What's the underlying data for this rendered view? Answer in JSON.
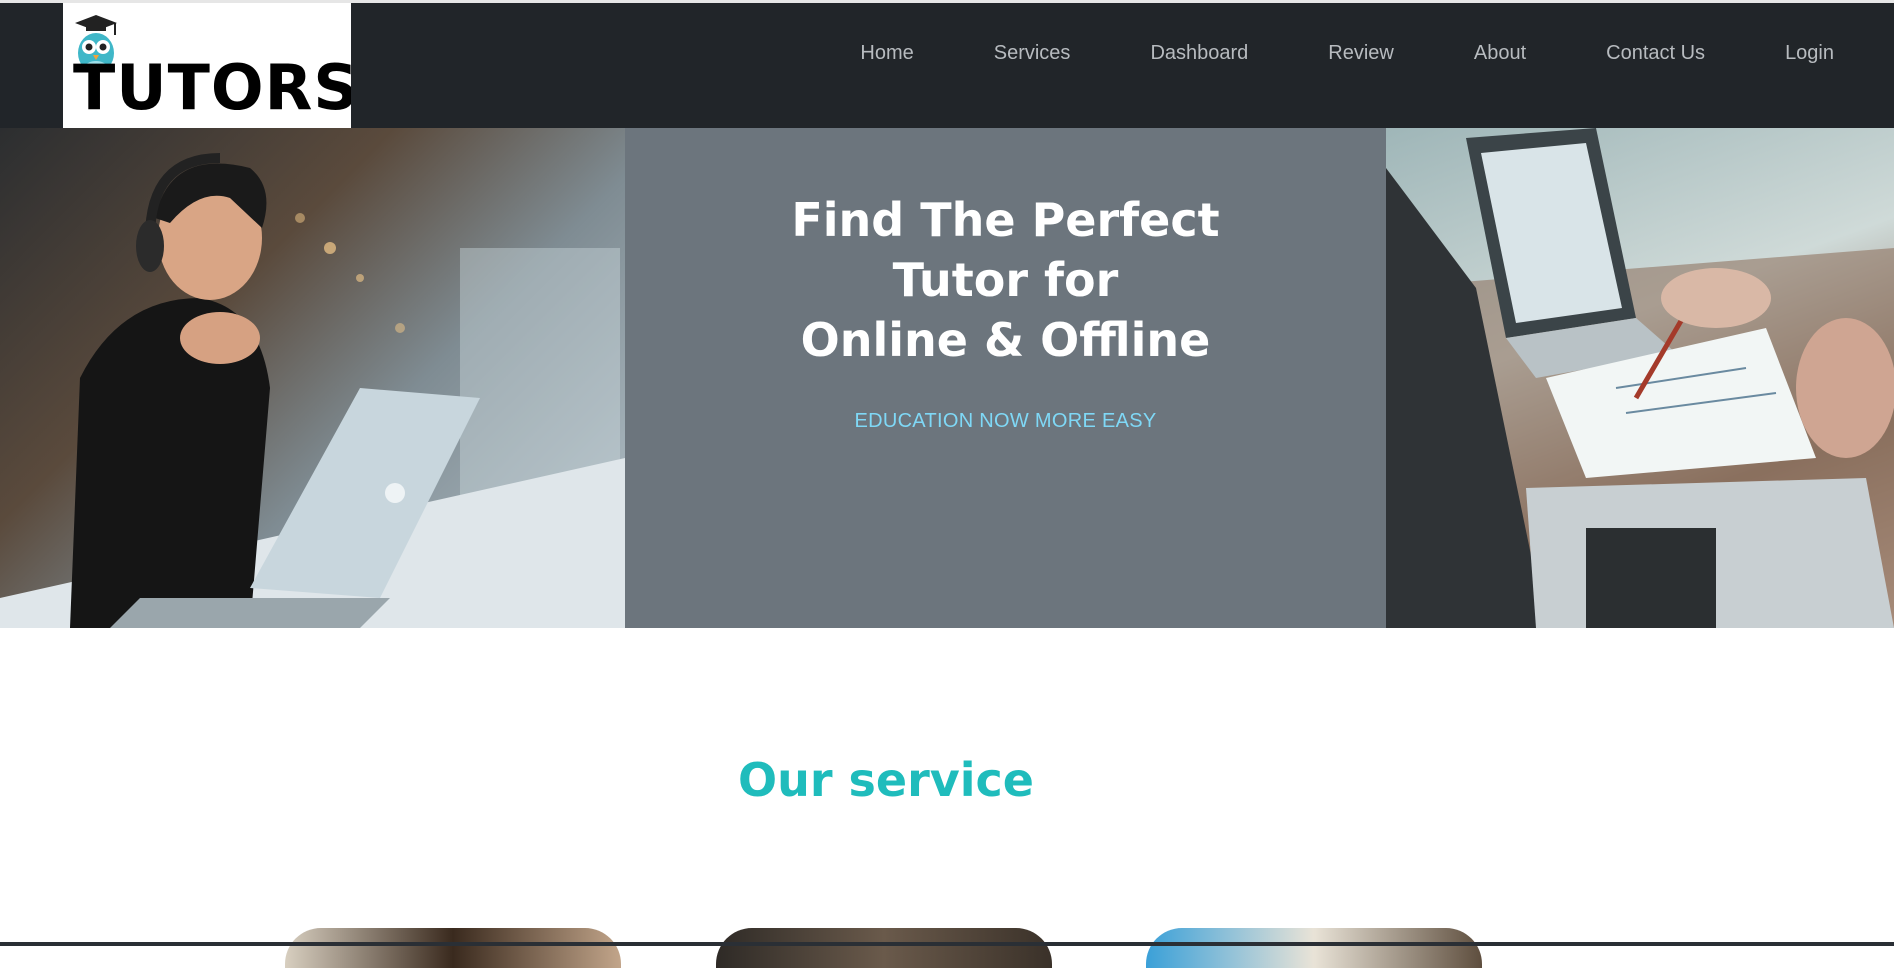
{
  "brand": {
    "logo_text": "TUTORS",
    "logo_icon": "graduation-owl-icon"
  },
  "nav": {
    "items": [
      {
        "label": "Home"
      },
      {
        "label": "Services"
      },
      {
        "label": "Dashboard"
      },
      {
        "label": "Review"
      },
      {
        "label": "About"
      },
      {
        "label": "Contact Us"
      },
      {
        "label": "Login"
      }
    ]
  },
  "hero": {
    "title_lines": [
      "Find The Perfect",
      "Tutor for",
      "Online & Offline"
    ],
    "subtitle": "EDUCATION NOW MORE EASY",
    "left_image": "student-with-laptop-photo",
    "right_image": "laptop-and-notes-photo"
  },
  "services": {
    "heading": "Our service",
    "cards": [
      {
        "image": "service-photo-1"
      },
      {
        "image": "service-photo-2"
      },
      {
        "image": "service-photo-3"
      }
    ]
  },
  "colors": {
    "navbar_bg": "#212529",
    "nav_text": "#b7bbbf",
    "hero_center_bg": "#6c757d",
    "hero_subtitle": "#7fd8f6",
    "service_heading": "#1fbcbc"
  }
}
